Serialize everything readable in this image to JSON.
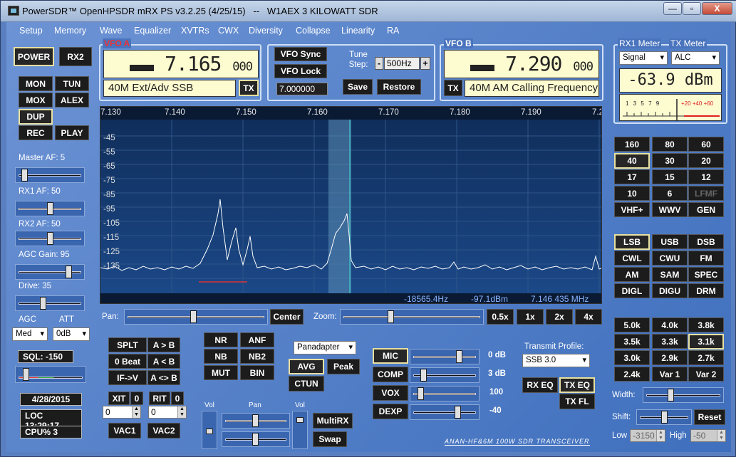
{
  "title": "PowerSDR™ OpenHPSDR mRX PS v3.2.25 (4/25/15)   --   W1AEX 3 KILOWATT SDR",
  "window_controls": {
    "minimize": "—",
    "maximize": "▫",
    "close": "X"
  },
  "menu": [
    "Setup",
    "Memory",
    "Wave",
    "Equalizer",
    "XVTRs",
    "CWX",
    "Diversity",
    "Collapse",
    "Linearity",
    "RA"
  ],
  "left": {
    "power": "POWER",
    "rx2": "RX2",
    "mon": "MON",
    "tun": "TUN",
    "mox": "MOX",
    "alex": "ALEX",
    "dup": "DUP",
    "rec": "REC",
    "play": "PLAY",
    "master_af": "Master AF:  5",
    "rx1_af": "RX1 AF:  50",
    "rx2_af": "RX2 AF:  50",
    "agc_gain": "AGC Gain:  95",
    "drive": "Drive:  35",
    "agc_label": "AGC",
    "att_label": "ATT",
    "agc_value": "Med",
    "att_value": "0dB",
    "sql": "SQL:  -150",
    "date": "4/28/2015",
    "loc": "LOC 13:29:17",
    "cpu": "CPU%  3"
  },
  "vfo_a": {
    "title": "VFO A",
    "freq_main": "7.165",
    "freq_sub": "000",
    "mode_text": "40M Ext/Adv SSB",
    "tx": "TX"
  },
  "vfo_mid": {
    "sync": "VFO Sync",
    "lock": "VFO Lock",
    "tune_step_label": "Tune Step:",
    "step_value": "500Hz",
    "minus": "-",
    "plus": "+",
    "freq_input": "7.000000",
    "save": "Save",
    "restore": "Restore"
  },
  "vfo_b": {
    "title": "VFO B",
    "freq_main": "7.290",
    "freq_sub": "000",
    "mode_text": "40M AM Calling Frequency",
    "tx": "TX"
  },
  "meter": {
    "rx1_label": "RX1 Meter",
    "tx_label": "TX Meter",
    "rx1_value": "Signal",
    "tx_value": "ALC",
    "reading": "-63.9 dBm",
    "scale": [
      "1",
      "3",
      "5",
      "7",
      "9",
      "+20",
      "+40",
      "+60"
    ]
  },
  "spectrum": {
    "freq_ticks": [
      "7.130",
      "7.140",
      "7.150",
      "7.160",
      "7.170",
      "7.180",
      "7.190",
      "7.2"
    ],
    "db_ticks": [
      "-45",
      "-55",
      "-65",
      "-75",
      "-85",
      "-95",
      "-105",
      "-115",
      "-125",
      "-135"
    ],
    "readout_offset": "-18565.4Hz",
    "readout_level": "-97.1dBm",
    "readout_freq": "7.146 435 MHz"
  },
  "pan_row": {
    "pan_label": "Pan:",
    "center": "Center",
    "zoom_label": "Zoom:",
    "z05": "0.5x",
    "z1": "1x",
    "z2": "2x",
    "z4": "4x"
  },
  "bands": [
    "160",
    "80",
    "60",
    "40",
    "30",
    "20",
    "17",
    "15",
    "12",
    "10",
    "6",
    "LFMF",
    "VHF+",
    "WWV",
    "GEN"
  ],
  "modes": [
    "LSB",
    "USB",
    "DSB",
    "CWL",
    "CWU",
    "FM",
    "AM",
    "SAM",
    "SPEC",
    "DIGL",
    "DIGU",
    "DRM"
  ],
  "filters": [
    "5.0k",
    "4.0k",
    "3.8k",
    "3.5k",
    "3.3k",
    "3.1k",
    "3.0k",
    "2.9k",
    "2.7k",
    "2.4k",
    "Var 1",
    "Var 2"
  ],
  "filter_ctrl": {
    "width": "Width:",
    "shift": "Shift:",
    "reset": "Reset",
    "low_label": "Low",
    "low_value": "-3150",
    "high_label": "High",
    "high_value": "-50"
  },
  "bottom": {
    "splt": "SPLT",
    "a_to_b": "A > B",
    "zero_beat": "0 Beat",
    "b_to_a": "A < B",
    "if_v": "IF->V",
    "a_swap_b": "A <> B",
    "xit": "XIT",
    "xit_val": "0",
    "rit": "RIT",
    "rit_val": "0",
    "xit_in": "0",
    "rit_in": "0",
    "vac1": "VAC1",
    "vac2": "VAC2",
    "nr": "NR",
    "anf": "ANF",
    "nb": "NB",
    "nb2": "NB2",
    "mut": "MUT",
    "bin": "BIN",
    "vol1": "Vol",
    "pan": "Pan",
    "vol2": "Vol",
    "multirx": "MultiRX",
    "swap": "Swap",
    "display_mode": "Panadapter",
    "avg": "AVG",
    "peak": "Peak",
    "ctun": "CTUN",
    "mic": "MIC",
    "mic_val": "0 dB",
    "comp": "COMP",
    "comp_val": "3 dB",
    "vox": "VOX",
    "vox_val": "100",
    "dexp": "DEXP",
    "dexp_val": "-40",
    "tx_profile_label": "Transmit Profile:",
    "tx_profile": "SSB 3.0",
    "rx_eq": "RX EQ",
    "tx_eq": "TX EQ",
    "tx_fl": "TX FL",
    "brand": "ANAN-HF&6M  100W SDR TRANSCEIVER"
  },
  "colors": {
    "accent": "#e8e0a0",
    "trace": "#ffffff",
    "filter_band": "#5d8fb8"
  }
}
